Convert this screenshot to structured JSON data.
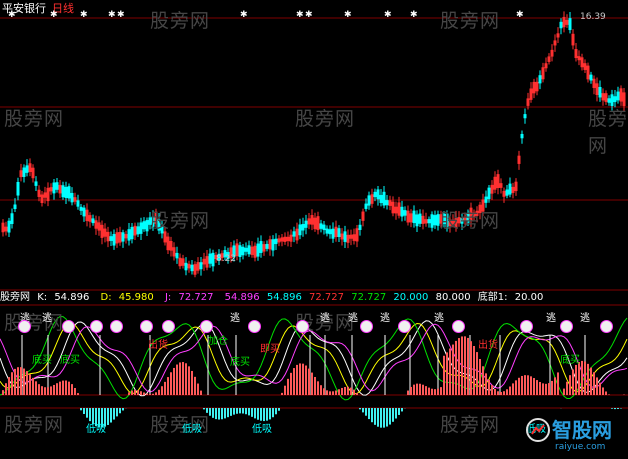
{
  "chart": {
    "stock_name": "平安银行",
    "period": "日线",
    "high_label": "16.39",
    "low_label": "8.22",
    "colors": {
      "up_candle": "#ff3030",
      "down_candle": "#00ffff",
      "grid": "#800000",
      "k_line": "#ffffff",
      "d_line": "#ffff00",
      "j_line": "#ff40ff",
      "histogram_pos": "#ff5a5a",
      "histogram_neg": "#40f0f0"
    },
    "star_marker": "✱",
    "indicator": {
      "name": "股旁网",
      "k_label": "K:",
      "k_value": "54.896",
      "d_label": "D:",
      "d_value": "45.980",
      "j_label": "J:",
      "j_value": "72.727",
      "v1": "54.896",
      "v2": "54.896",
      "v3": "72.727",
      "v4": "72.727",
      "v5": "20.000",
      "v6": "80.000",
      "bottom_label": "底部1:",
      "bottom_value": "20.00"
    },
    "signals": {
      "escape": "逃",
      "bottom_buy": "底买",
      "low_buy": "低吸",
      "add_position": "加仓",
      "tip": "即买",
      "sell": "出货"
    }
  },
  "watermark": {
    "text": "股旁网"
  },
  "logo": {
    "name": "智股网",
    "url": "raiyue.com"
  }
}
